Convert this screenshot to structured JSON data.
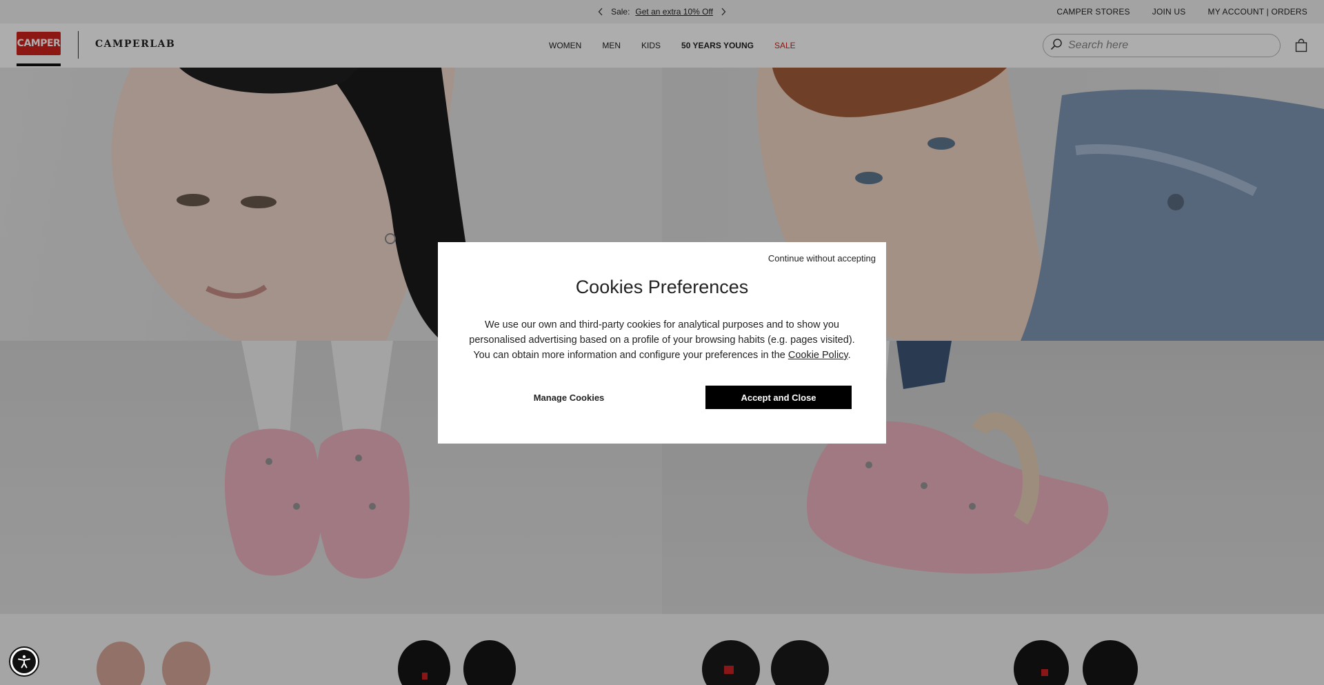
{
  "promo": {
    "prefix": "Sale:",
    "link_text": "Get an extra 10% Off"
  },
  "top_links": {
    "stores": "CAMPER STORES",
    "join": "JOIN US",
    "account": "MY ACCOUNT | ORDERS"
  },
  "header": {
    "logo_text": "CAMPER",
    "sublogo": "CAMPERLAB",
    "nav": {
      "women": "WOMEN",
      "men": "MEN",
      "kids": "KIDS",
      "years": "50 YEARS YOUNG",
      "sale": "SALE"
    },
    "search_placeholder": "Search here"
  },
  "modal": {
    "continue": "Continue without accepting",
    "title": "Cookies Preferences",
    "body_text": "We use our own and third-party cookies for analytical purposes and to show you personalised advertising based on a profile of your browsing habits (e.g. pages visited). You can obtain more information and configure your preferences in the",
    "policy_link": "Cookie Policy",
    "body_end": ".",
    "manage_label": "Manage Cookies",
    "accept_label": "Accept and Close"
  },
  "icons": {
    "prev": "chevron-left-icon",
    "next": "chevron-right-icon",
    "search": "search-icon",
    "bag": "shopping-bag-icon",
    "accessibility": "accessibility-icon"
  },
  "colors": {
    "brand_red": "#d0221b",
    "accept_bg": "#000000",
    "overlay": "rgba(0,0,0,0.32)"
  }
}
